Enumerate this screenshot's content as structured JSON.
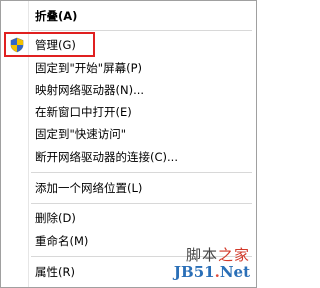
{
  "menu": {
    "items": [
      {
        "label": "折叠(A)",
        "bold": true
      },
      {
        "label": "管理(G)",
        "icon": "shield-icon"
      },
      {
        "label": "固定到\"开始\"屏幕(P)"
      },
      {
        "label": "映射网络驱动器(N)..."
      },
      {
        "label": "在新窗口中打开(E)"
      },
      {
        "label": "固定到\"快速访问\""
      },
      {
        "label": "断开网络驱动器的连接(C)..."
      },
      {
        "label": "添加一个网络位置(L)"
      },
      {
        "label": "删除(D)"
      },
      {
        "label": "重命名(M)"
      },
      {
        "label": "属性(R)"
      }
    ]
  },
  "watermark": {
    "top_prefix": "脚本",
    "top_accent": "之家",
    "bottom_prefix": "JB51",
    "bottom_accent": ".",
    "bottom_suffix": "Net"
  },
  "colors": {
    "highlight_box": "#e02020",
    "separator": "#d8d8d8"
  }
}
